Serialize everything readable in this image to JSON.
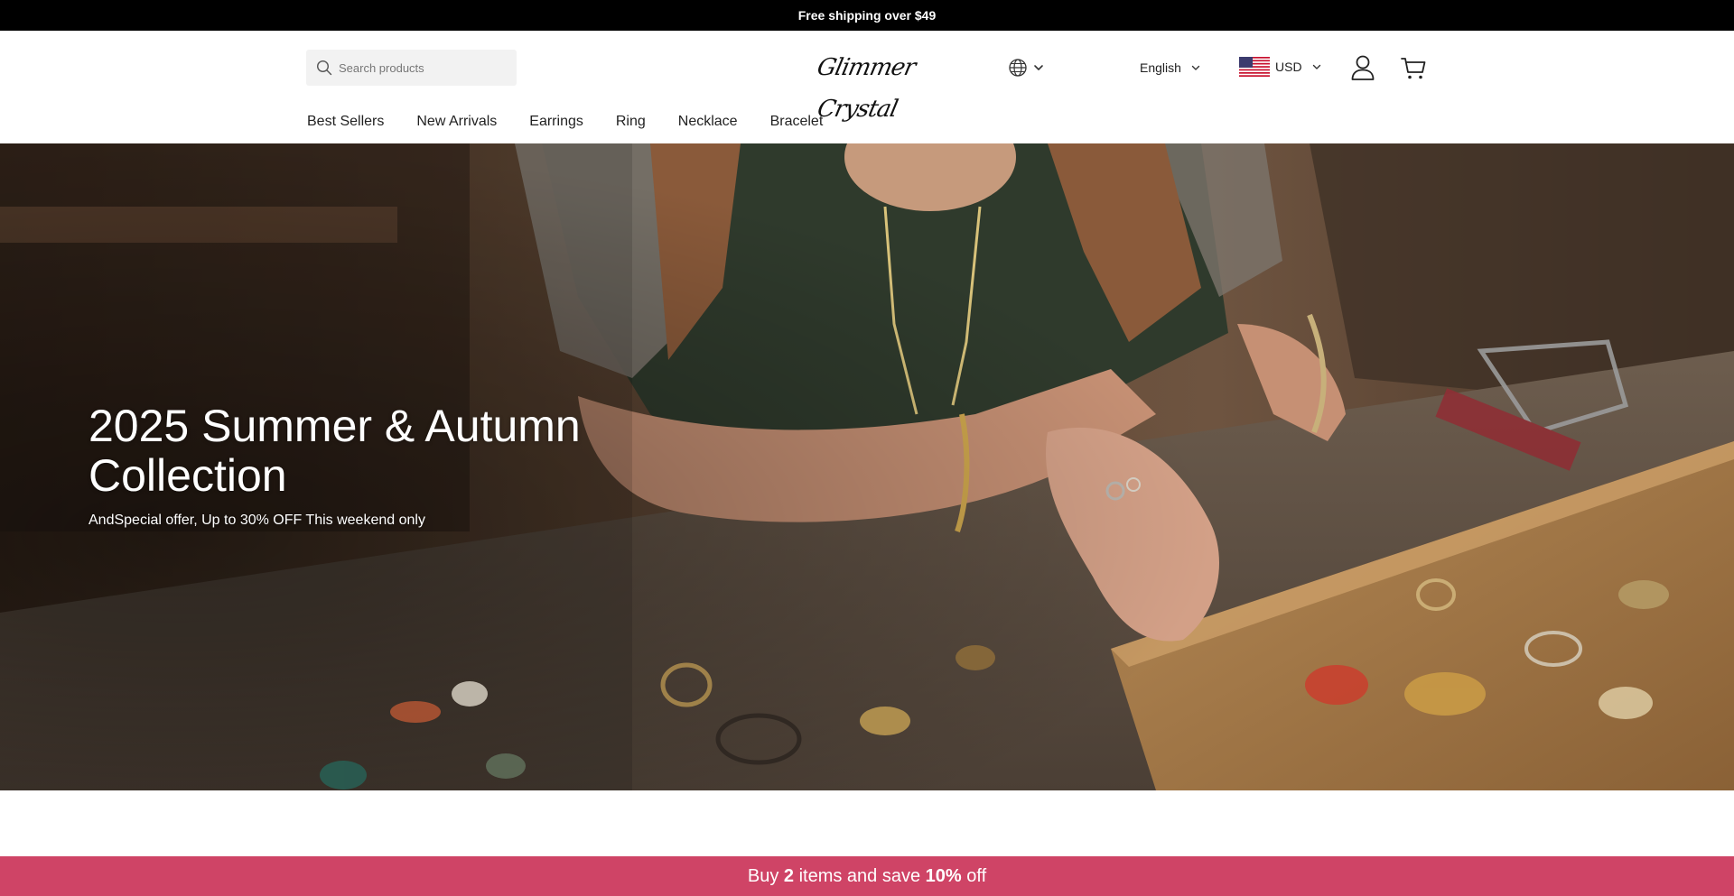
{
  "announcement": {
    "text": "Free shipping over $49"
  },
  "header": {
    "search": {
      "placeholder": "Search products",
      "value": "",
      "icon": "search-icon"
    },
    "logo": {
      "text": "Glimmer Crystal"
    },
    "region": {
      "icon": "globe-icon"
    },
    "language": {
      "label": "English"
    },
    "currency": {
      "label": "USD",
      "flag": "us-flag"
    },
    "account": {
      "icon": "user-icon"
    },
    "cart": {
      "icon": "cart-icon"
    }
  },
  "nav": {
    "items": [
      {
        "label": "Best Sellers"
      },
      {
        "label": "New Arrivals"
      },
      {
        "label": "Earrings"
      },
      {
        "label": "Ring"
      },
      {
        "label": "Necklace"
      },
      {
        "label": "Bracelet"
      }
    ]
  },
  "hero": {
    "title": "2025 Summer & Autumn Collection",
    "subtitle": "AndSpecial offer, Up to 30% OFF This weekend only"
  },
  "promo": {
    "prefix": "Buy ",
    "quantity": "2",
    "middle": " items and save ",
    "discount": "10%",
    "suffix": " off",
    "color": "#cf4466"
  }
}
